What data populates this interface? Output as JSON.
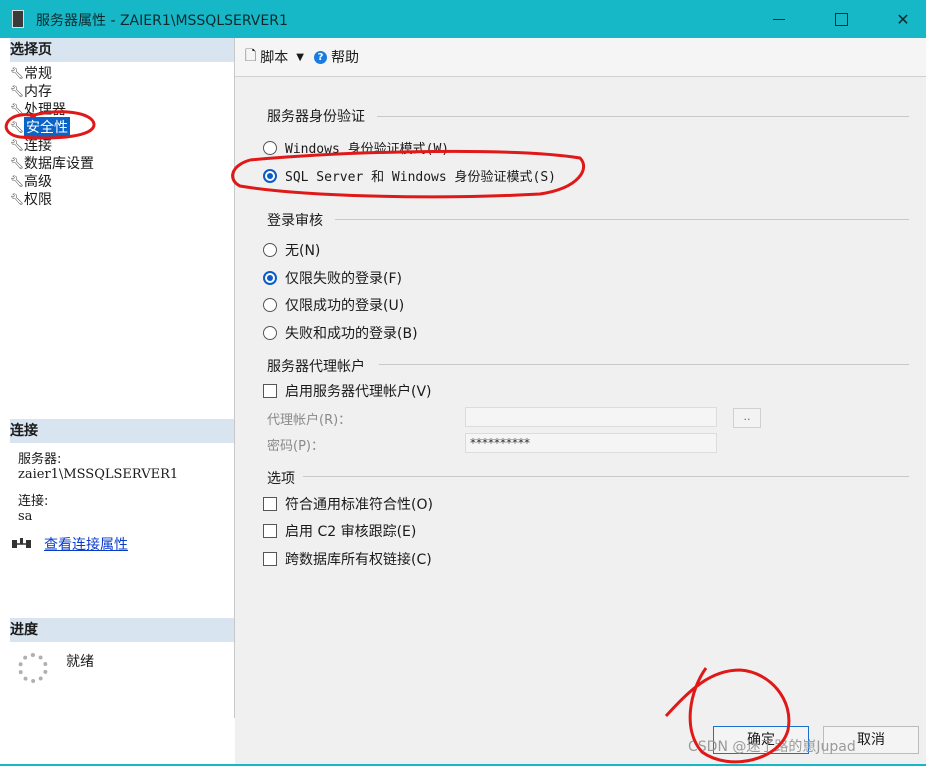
{
  "window": {
    "title": "服务器属性 - ZAIER1\\MSSQLSERVER1",
    "accent_color": "#16b8c8"
  },
  "left_panel": {
    "select_page_title": "选择页",
    "pages": [
      {
        "label": "常规",
        "selected": false
      },
      {
        "label": "内存",
        "selected": false
      },
      {
        "label": "处理器",
        "selected": false
      },
      {
        "label": "安全性",
        "selected": true
      },
      {
        "label": "连接",
        "selected": false
      },
      {
        "label": "数据库设置",
        "selected": false
      },
      {
        "label": "高级",
        "selected": false
      },
      {
        "label": "权限",
        "selected": false
      }
    ],
    "connection_title": "连接",
    "server_label": "服务器:",
    "server_value": "zaier1\\MSSQLSERVER1",
    "connection_label": "连接:",
    "connection_value": "sa",
    "view_connection_link": "查看连接属性",
    "progress_title": "进度",
    "progress_status": "就绪"
  },
  "toolbar": {
    "script_label": "脚本",
    "help_label": "帮助"
  },
  "auth": {
    "title": "服务器身份验证",
    "options": [
      {
        "label": "Windows 身份验证模式(W)",
        "selected": false
      },
      {
        "label": "SQL Server 和 Windows 身份验证模式(S)",
        "selected": true
      }
    ]
  },
  "login_audit": {
    "title": "登录审核",
    "options": [
      {
        "label": "无(N)",
        "selected": false
      },
      {
        "label": "仅限失败的登录(F)",
        "selected": true
      },
      {
        "label": "仅限成功的登录(U)",
        "selected": false
      },
      {
        "label": "失败和成功的登录(B)",
        "selected": false
      }
    ]
  },
  "proxy": {
    "title": "服务器代理帐户",
    "enable_label": "启用服务器代理帐户(V)",
    "enabled": false,
    "account_label": "代理帐户(R)：",
    "account_value": "",
    "password_label": "密码(P)：",
    "password_value": "**********",
    "browse_label": ".."
  },
  "options": {
    "title": "选项",
    "items": [
      {
        "label": "符合通用标准符合性(O)",
        "checked": false
      },
      {
        "label": "启用 C2 审核跟踪(E)",
        "checked": false
      },
      {
        "label": "跨数据库所有权链接(C)",
        "checked": false
      }
    ]
  },
  "buttons": {
    "ok_label": "确定",
    "cancel_label": "取消"
  },
  "watermark": "CSDN @迷了路的崽Jupad",
  "annotation_color": "#e01818"
}
